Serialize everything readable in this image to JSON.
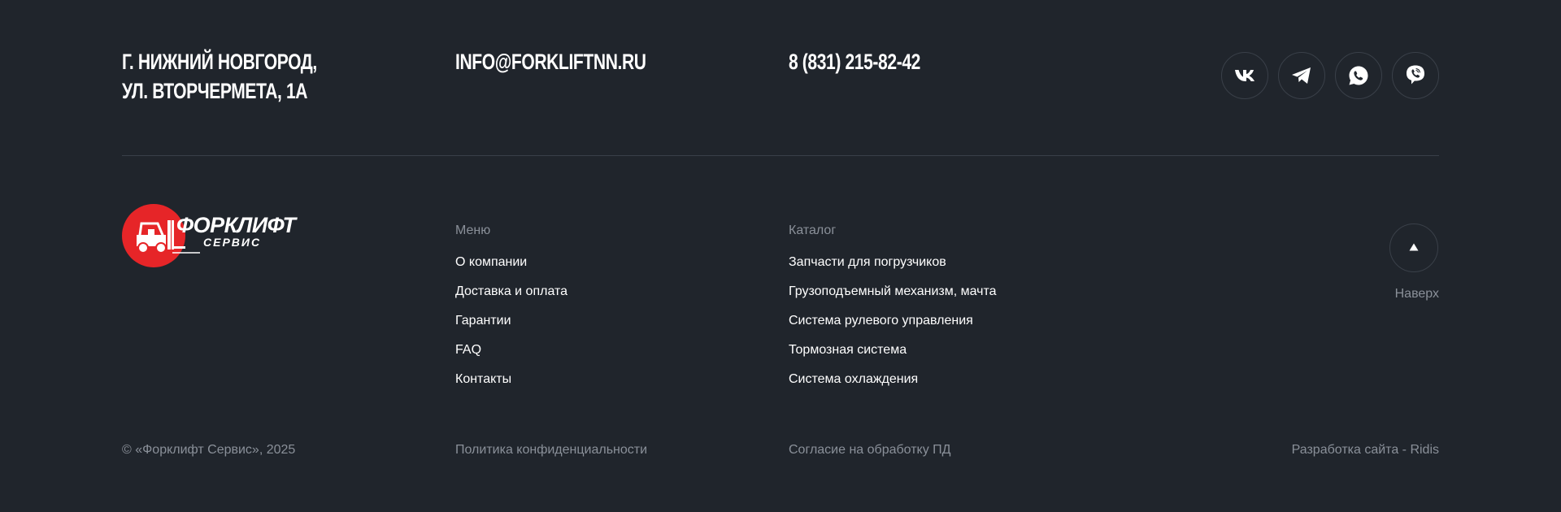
{
  "contacts": {
    "address_line1": "г. Нижний Новгород,",
    "address_line2": "ул. Вторчермета, 1А",
    "email": "info@forkliftnn.ru",
    "phone": "8 (831) 215-82-42"
  },
  "socials": [
    {
      "icon": "vk-icon"
    },
    {
      "icon": "telegram-icon"
    },
    {
      "icon": "whatsapp-icon"
    },
    {
      "icon": "viber-icon"
    }
  ],
  "logo": {
    "title": "ФОРКЛИФТ",
    "subtitle": "СЕРВИС",
    "accent_color": "#e62528"
  },
  "menu": {
    "title": "Меню",
    "items": [
      {
        "label": "О компании"
      },
      {
        "label": "Доставка и оплата"
      },
      {
        "label": "Гарантии"
      },
      {
        "label": "FAQ"
      },
      {
        "label": "Контакты"
      }
    ]
  },
  "catalog": {
    "title": "Каталог",
    "items": [
      {
        "label": "Запчасти для погрузчиков"
      },
      {
        "label": "Грузоподъемный механизм, мачта"
      },
      {
        "label": "Система рулевого управления"
      },
      {
        "label": "Тормозная система"
      },
      {
        "label": "Система охлаждения"
      }
    ]
  },
  "to_top": {
    "label": "Наверх",
    "icon": "arrow-up-icon"
  },
  "bottom": {
    "copyright": "© «Форклифт Сервис», 2025",
    "privacy": "Политика конфиденциальности",
    "consent": "Согласие на обработку ПД",
    "developer": "Разработка сайта - Ridis"
  },
  "colors": {
    "background": "#20252c",
    "muted_text": "#8a9099",
    "divider": "#3a4049"
  }
}
